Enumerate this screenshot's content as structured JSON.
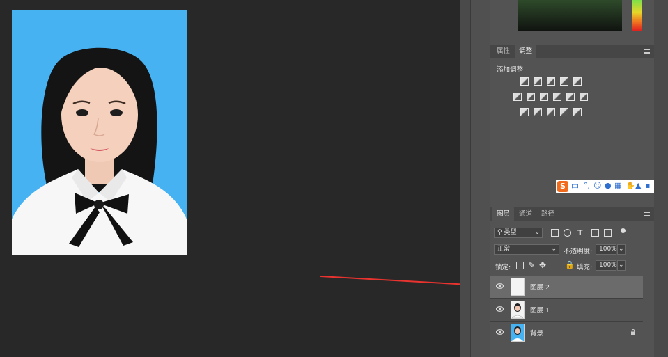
{
  "properties_panel": {
    "tabs": [
      "属性",
      "调整"
    ],
    "active_tab": "调整",
    "add_adjustment_label": "添加调整"
  },
  "ime_toolbar": {
    "logo": "S",
    "mode": "中",
    "icons": [
      "punctuation-icon",
      "emoji-icon",
      "microphone-icon",
      "keyboard-icon",
      "hand-icon",
      "skin-icon",
      "grid-icon"
    ]
  },
  "layers_panel": {
    "tabs": [
      "图层",
      "通道",
      "路径"
    ],
    "active_tab": "图层",
    "filter_kind": "类型",
    "blend_mode": "正常",
    "opacity_label": "不透明度:",
    "opacity_value": "100%",
    "lock_label": "锁定:",
    "fill_label": "填充:",
    "fill_value": "100%",
    "layers": [
      {
        "name": "图层 2",
        "selected": true,
        "visible": true,
        "locked": false
      },
      {
        "name": "图层 1",
        "selected": false,
        "visible": true,
        "locked": false
      },
      {
        "name": "背景",
        "selected": false,
        "visible": true,
        "locked": true
      }
    ]
  },
  "colors": {
    "canvas_bg": "#282828",
    "photo_bg": "#45b0f0",
    "panel_bg": "#535353",
    "arrow": "#e8332f"
  }
}
